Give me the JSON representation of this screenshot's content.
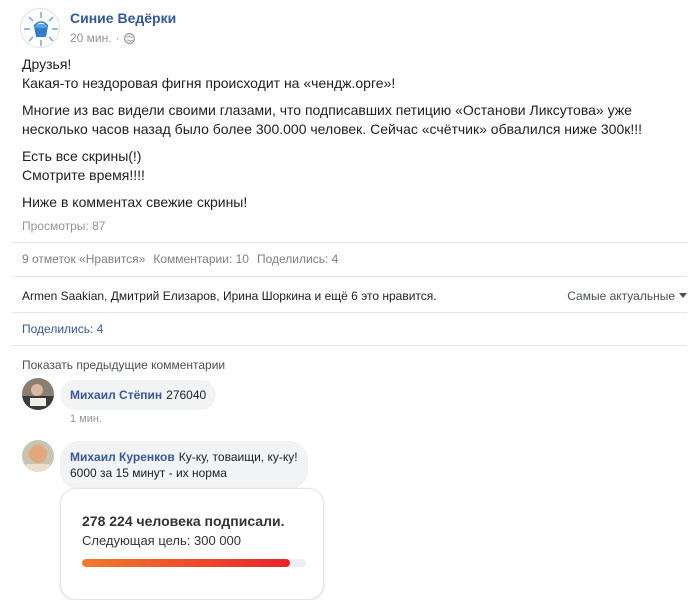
{
  "post": {
    "page_name": "Синие Ведёрки",
    "time": "20 мин.",
    "privacy_icon": "globe-icon",
    "paragraphs": [
      [
        "Друзья!",
        "Какая-то нездоровая фигня происходит на «чендж.орге»!"
      ],
      [
        "Многие из вас видели своими глазами, что подписавших петицию «Останови Ликсутова» уже несколько часов назад было более 300.000 человек. Сейчас «счётчик» обвалился ниже 300к!!!"
      ],
      [
        "Есть все скрины(!)",
        "Смотрите время!!!!"
      ],
      [
        "Ниже в комментах свежие скрины!"
      ]
    ],
    "views": "Просмотры: 87"
  },
  "stats": {
    "likes": "9 отметок «Нравится»",
    "comments": "Комментарии: 10",
    "shares": "Поделились: 4"
  },
  "reactions": {
    "likers": "Armen Saakian, Дмитрий Елизаров, Ирина Шоркина и ещё 6 это нравится.",
    "sort_label": "Самые актуальные",
    "shares_link": "Поделились: 4"
  },
  "comments": {
    "show_previous": "Показать предыдущие комментарии",
    "items": [
      {
        "author": "Михаил Стёпин",
        "text": "276040",
        "time": "1 мин."
      },
      {
        "author": "Михаил Куренков",
        "text": "Ку-ку, товаищи, ку-ку!",
        "text2": "6000 за 15 минут - их норма"
      }
    ]
  },
  "petition_card": {
    "signed": "278 224 человека подписали.",
    "next_goal": "Следующая цель: 300 000",
    "progress": 0.927
  },
  "colors": {
    "link_blue": "#365899",
    "meta_gray": "#90949c",
    "bubble_bg": "#f2f3f5",
    "progress_start": "#f07b2b",
    "progress_end": "#e8232b"
  }
}
